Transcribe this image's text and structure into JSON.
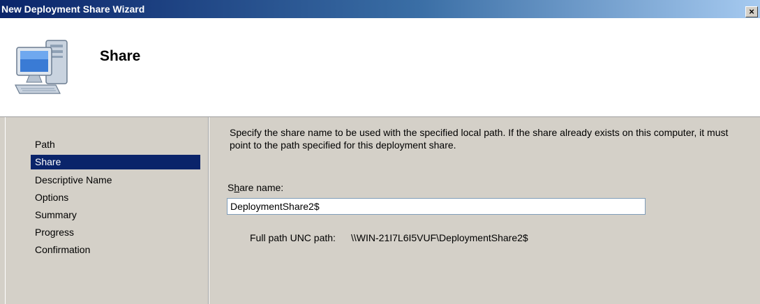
{
  "window": {
    "title": "New Deployment Share Wizard",
    "close_label": "×"
  },
  "header": {
    "title": "Share",
    "icon": "computer-icon"
  },
  "nav": {
    "items": [
      {
        "label": "Path",
        "selected": false
      },
      {
        "label": "Share",
        "selected": true
      },
      {
        "label": "Descriptive Name",
        "selected": false
      },
      {
        "label": "Options",
        "selected": false
      },
      {
        "label": "Summary",
        "selected": false
      },
      {
        "label": "Progress",
        "selected": false
      },
      {
        "label": "Confirmation",
        "selected": false
      }
    ]
  },
  "main": {
    "description": "Specify the share name to be used with the specified local path.  If the share already exists on this computer, it must point to the path specified for this deployment share.",
    "share_label_prefix": "S",
    "share_label_accel": "h",
    "share_label_rest": "are name:",
    "share_value": "DeploymentShare2$",
    "unc_label": "Full path UNC path:",
    "unc_value": "\\\\WIN-21I7L6I5VUF\\DeploymentShare2$"
  },
  "colors": {
    "selection": "#0a246a",
    "title_gradient_start": "#0a246a",
    "title_gradient_end": "#a6caf0"
  }
}
